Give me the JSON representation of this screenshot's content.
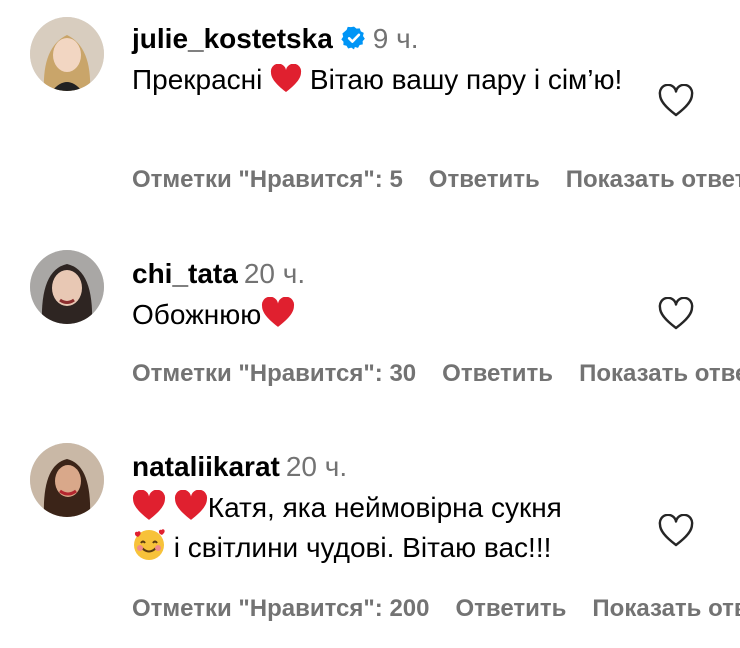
{
  "comments": [
    {
      "username": "julie_kostetska",
      "verified": true,
      "time": "9 ч.",
      "text_a": "Прекрасні",
      "text_b": "Вітаю вашу пару і сім’ю!",
      "likes": "Отметки \"Нравится\": 5",
      "reply": "Ответить",
      "show": "Показать ответы"
    },
    {
      "username": "chi_tata",
      "verified": false,
      "time": "20 ч.",
      "text_a": "Обожнюю",
      "likes": "Отметки \"Нравится\": 30",
      "reply": "Ответить",
      "show": "Показать ответы"
    },
    {
      "username": "nataliikarat",
      "verified": false,
      "time": "20 ч.",
      "text_a": "Катя, яка неймовірна сукня",
      "text_b": "і світлини чудові. Вітаю вас!!!",
      "likes": "Отметки \"Нравится\": 200",
      "reply": "Ответить",
      "show": "Показать ответы"
    }
  ],
  "colors": {
    "verified": "#0095f6",
    "muted": "#737373",
    "heart_emoji": "#e0202f"
  },
  "icons": {
    "like": "heart-outline-icon",
    "verified": "verified-badge-icon",
    "emoji_heart": "red-heart-emoji",
    "emoji_smile": "smiling-face-with-hearts-emoji"
  }
}
